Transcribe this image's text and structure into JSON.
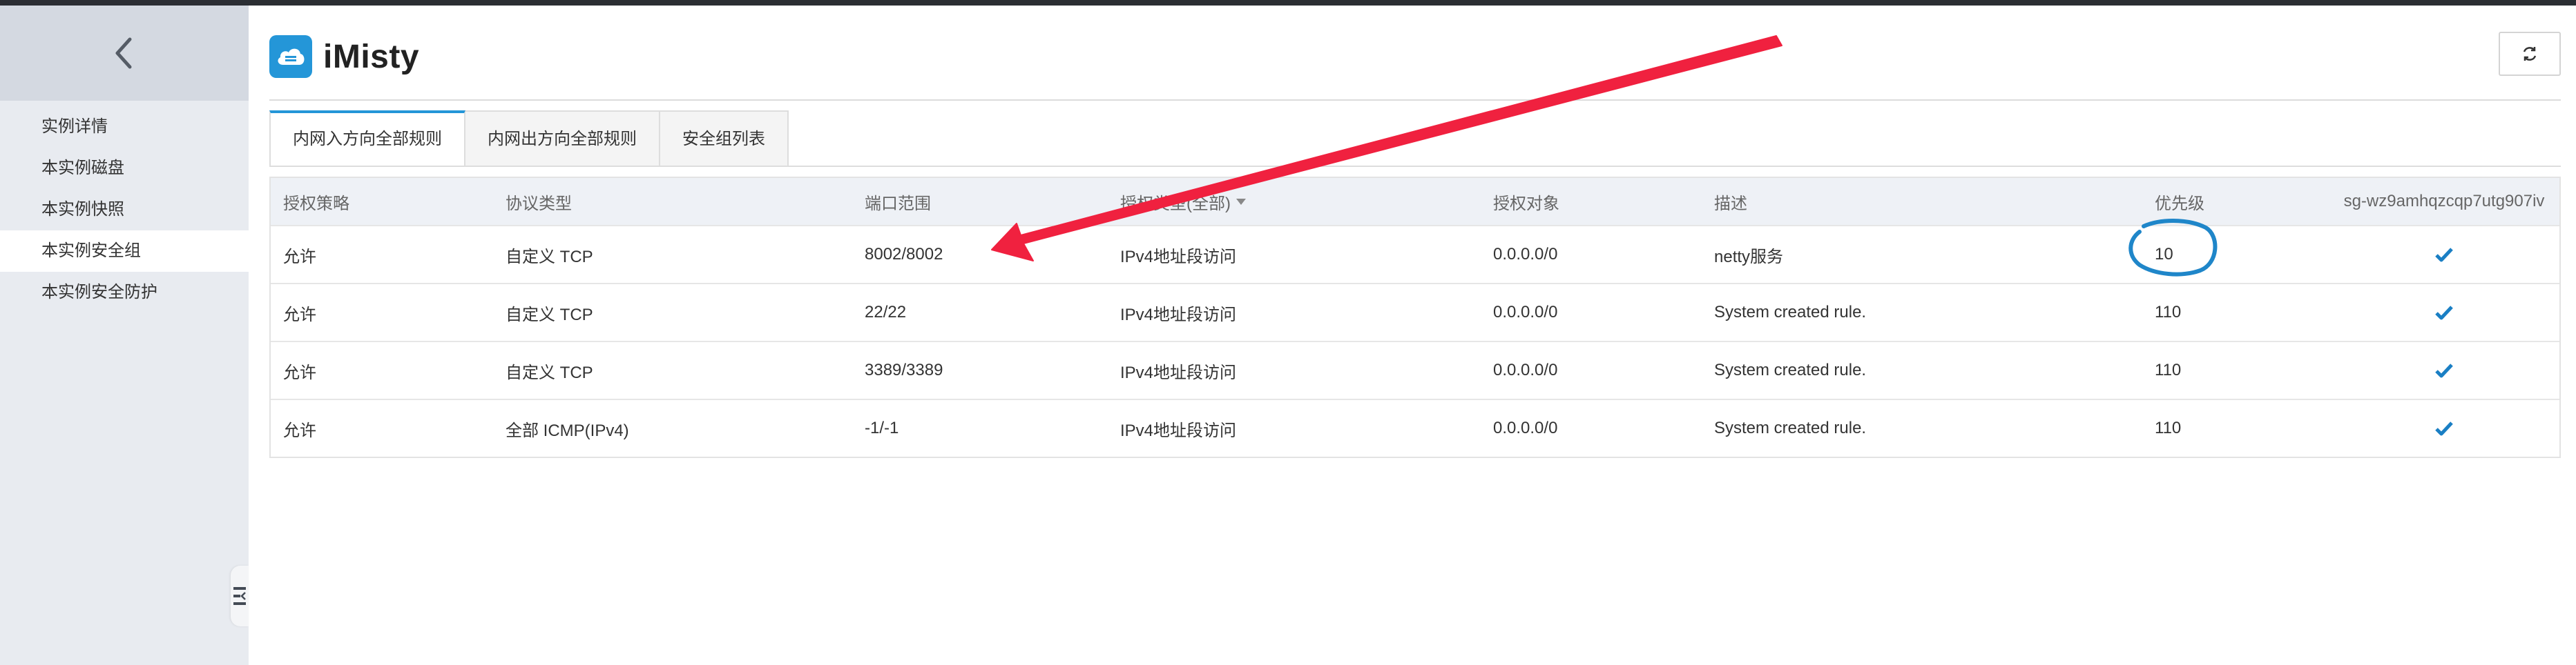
{
  "sidebar": {
    "items": [
      {
        "label": "实例详情",
        "active": false
      },
      {
        "label": "本实例磁盘",
        "active": false
      },
      {
        "label": "本实例快照",
        "active": false
      },
      {
        "label": "本实例安全组",
        "active": true
      },
      {
        "label": "本实例安全防护",
        "active": false
      }
    ]
  },
  "header": {
    "title": "iMisty"
  },
  "tabs": [
    {
      "label": "内网入方向全部规则",
      "active": true
    },
    {
      "label": "内网出方向全部规则",
      "active": false
    },
    {
      "label": "安全组列表",
      "active": false
    }
  ],
  "table": {
    "columns": [
      "授权策略",
      "协议类型",
      "端口范围",
      "授权类型(全部)",
      "授权对象",
      "描述",
      "优先级"
    ],
    "security_group_link": "sg-wz9amhqzcqp7utg907iv",
    "rows": [
      {
        "policy": "允许",
        "protocol": "自定义 TCP",
        "port": "8002/8002",
        "auth_type": "IPv4地址段访问",
        "target": "0.0.0.0/0",
        "desc": "netty服务",
        "priority": "10"
      },
      {
        "policy": "允许",
        "protocol": "自定义 TCP",
        "port": "22/22",
        "auth_type": "IPv4地址段访问",
        "target": "0.0.0.0/0",
        "desc": "System created rule.",
        "priority": "110"
      },
      {
        "policy": "允许",
        "protocol": "自定义 TCP",
        "port": "3389/3389",
        "auth_type": "IPv4地址段访问",
        "target": "0.0.0.0/0",
        "desc": "System created rule.",
        "priority": "110"
      },
      {
        "policy": "允许",
        "protocol": "全部 ICMP(IPv4)",
        "port": "-1/-1",
        "auth_type": "IPv4地址段访问",
        "target": "0.0.0.0/0",
        "desc": "System created rule.",
        "priority": "110"
      }
    ]
  },
  "icons": {
    "back": "chevron-left-icon",
    "logo": "cloud-server-icon",
    "refresh": "refresh-icon",
    "check": "check-icon",
    "collapse": "sidebar-collapse-icon"
  },
  "colors": {
    "accent": "#2496d8",
    "link": "#0b5fbf",
    "annotation_arrow": "#f0213f",
    "annotation_circle": "#1f86c9"
  }
}
